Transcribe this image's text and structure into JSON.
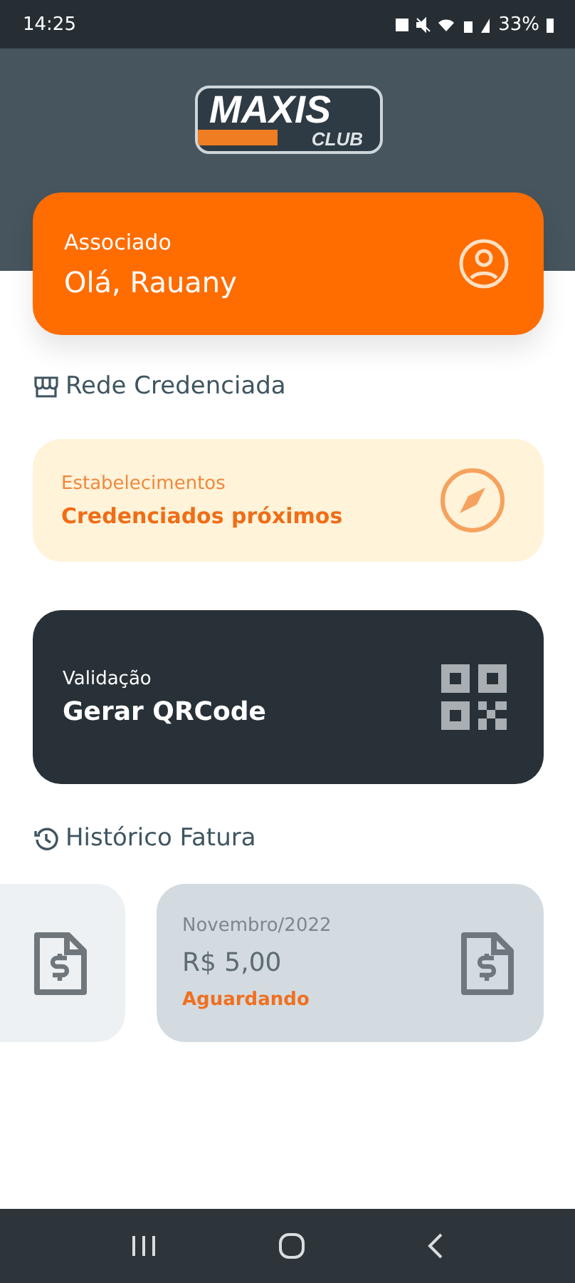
{
  "status_bar": {
    "time": "14:25",
    "battery": "33%"
  },
  "logo": {
    "title": "MAXIS",
    "subtitle": "CLUB"
  },
  "member_card": {
    "label": "Associado",
    "greeting": "Olá, Rauany"
  },
  "network_section": {
    "title": "Rede Credenciada"
  },
  "nearby_card": {
    "label": "Estabelecimentos",
    "title": "Credenciados próximos"
  },
  "qr_card": {
    "label": "Validação",
    "title": "Gerar QRCode"
  },
  "history_section": {
    "title": "Histórico Fatura"
  },
  "invoices": [
    {
      "month": "Novembro/2022",
      "amount": "R$ 5,00",
      "status": "Aguardando"
    }
  ]
}
